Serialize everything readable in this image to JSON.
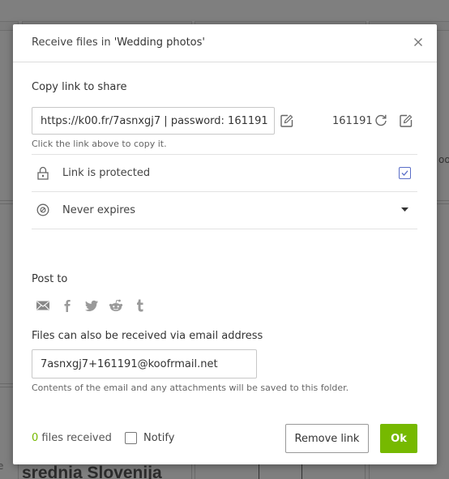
{
  "background": {
    "visible_text_1": "srednia Slovenija",
    "visible_text_2": "e",
    "visible_text_3": "oo"
  },
  "modal": {
    "title_prefix": "Receive files in ",
    "title_folder": "'Wedding photos'",
    "close_icon": "close-icon",
    "copy_link": {
      "label": "Copy link to share",
      "link_value": "https://k00.fr/7asnxgj7 | password: 161191",
      "edit_link_icon": "edit-icon",
      "password": "161191",
      "regenerate_icon": "refresh-icon",
      "edit_password_icon": "edit-icon",
      "hint": "Click the link above to copy it."
    },
    "protection": {
      "icon": "lock-icon",
      "label": "Link is protected",
      "checked": true
    },
    "expiry": {
      "icon": "no-expiry-icon",
      "label": "Never expires",
      "dropdown_icon": "caret-down-icon"
    },
    "post_to": {
      "label": "Post to",
      "icons": [
        "email-icon",
        "facebook-icon",
        "twitter-icon",
        "reddit-icon",
        "tumblr-icon"
      ]
    },
    "email_receive": {
      "label": "Files can also be received via email address",
      "value": "7asnxgj7+161191@koofrmail.net",
      "hint": "Contents of the email and any attachments will be saved to this folder."
    },
    "footer": {
      "files_count": "0",
      "files_label": " files received",
      "notify_label": "Notify",
      "notify_checked": false,
      "remove_link_label": "Remove link",
      "ok_label": "Ok"
    }
  },
  "colors": {
    "accent": "#76b900",
    "checkbox_checked": "#5a6ec8",
    "overlay": "#7f7f7f"
  }
}
